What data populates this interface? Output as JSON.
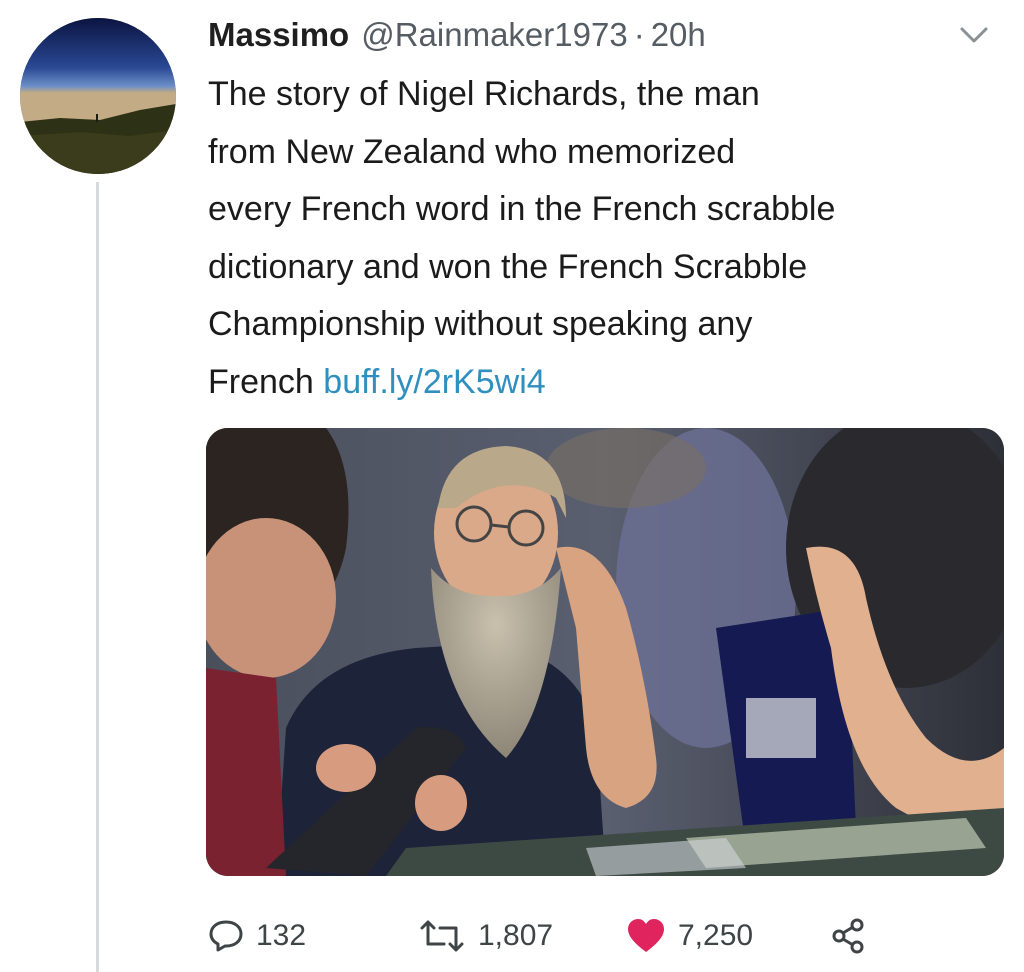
{
  "tweet": {
    "author_name": "Massimo",
    "handle": "@Rainmaker1973",
    "separator": "·",
    "time": "20h",
    "text_lines": [
      "The story of Nigel Richards, the man",
      "from New Zealand  who memorized",
      "every French word in the French scrabble",
      "dictionary and won the French Scrabble",
      "Championship without speaking any"
    ],
    "last_line_text": "French",
    "link": "buff.ly/2rK5wi4",
    "link_color": "#2f8fbf"
  },
  "icons": {
    "avatar": "landscape-avatar",
    "menu": "chevron-down-icon",
    "reply": "reply-icon",
    "retweet": "retweet-icon",
    "like": "heart-icon",
    "share": "share-icon"
  },
  "actions": {
    "replies": "132",
    "retweets": "1,807",
    "likes": "7,250",
    "like_color": "#e0245e"
  }
}
